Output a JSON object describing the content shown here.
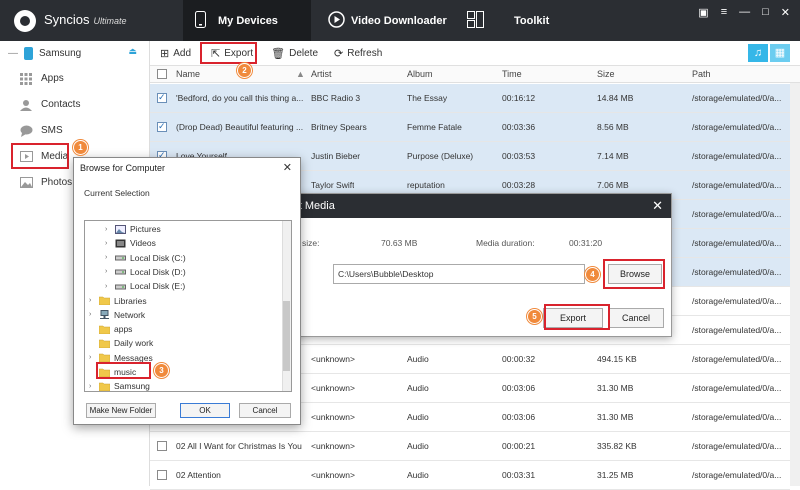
{
  "app": {
    "name": "Syncios",
    "edition": "Ultimate"
  },
  "nav": [
    {
      "label": "My Devices",
      "icon": "phone-icon"
    },
    {
      "label": "Video Downloader",
      "icon": "play-icon"
    },
    {
      "label": "Toolkit",
      "icon": "grid-icon"
    }
  ],
  "sidebar": {
    "device": "Samsung",
    "items": [
      {
        "label": "Apps"
      },
      {
        "label": "Contacts"
      },
      {
        "label": "SMS"
      },
      {
        "label": "Media"
      },
      {
        "label": "Photos"
      }
    ]
  },
  "toolbar": {
    "add": "Add",
    "export": "Export",
    "delete": "Delete",
    "refresh": "Refresh"
  },
  "columns": [
    "Name",
    "Artist",
    "Album",
    "Time",
    "Size",
    "Path"
  ],
  "rows": [
    {
      "checked": true,
      "name": "'Bedford, do you call this thing a...",
      "artist": "BBC Radio 3",
      "album": "The Essay",
      "time": "00:16:12",
      "size": "14.84 MB",
      "path": "/storage/emulated/0/a..."
    },
    {
      "checked": true,
      "name": "(Drop Dead) Beautiful featuring ...",
      "artist": "Britney Spears",
      "album": "Femme Fatale",
      "time": "00:03:36",
      "size": "8.56 MB",
      "path": "/storage/emulated/0/a..."
    },
    {
      "checked": true,
      "name": "Love Yourself",
      "artist": "Justin Bieber",
      "album": "Purpose (Deluxe)",
      "time": "00:03:53",
      "size": "7.14 MB",
      "path": "/storage/emulated/0/a..."
    },
    {
      "checked": true,
      "name": "",
      "artist": "Taylor Swift",
      "album": "reputation",
      "time": "00:03:28",
      "size": "7.06 MB",
      "path": "/storage/emulated/0/a..."
    },
    {
      "checked": true,
      "name": "",
      "artist": "",
      "album": "",
      "time": "",
      "size": "",
      "path": "/storage/emulated/0/a..."
    },
    {
      "checked": true,
      "name": "",
      "artist": "",
      "album": "",
      "time": "",
      "size": "",
      "path": "/storage/emulated/0/a..."
    },
    {
      "checked": true,
      "name": "",
      "artist": "",
      "album": "",
      "time": "",
      "size": "",
      "path": "/storage/emulated/0/a..."
    },
    {
      "checked": false,
      "name": "",
      "artist": "",
      "album": "",
      "time": "",
      "size": "",
      "path": "/storage/emulated/0/a..."
    },
    {
      "checked": false,
      "name": "",
      "artist": "",
      "album": "",
      "time": "",
      "size": "",
      "path": "/storage/emulated/0/a..."
    },
    {
      "checked": false,
      "name": "",
      "artist": "<unknown>",
      "album": "Audio",
      "time": "00:00:32",
      "size": "494.15 KB",
      "path": "/storage/emulated/0/a..."
    },
    {
      "checked": false,
      "name": "",
      "artist": "<unknown>",
      "album": "Audio",
      "time": "00:03:06",
      "size": "31.30 MB",
      "path": "/storage/emulated/0/a..."
    },
    {
      "checked": false,
      "name": "",
      "artist": "<unknown>",
      "album": "Audio",
      "time": "00:03:06",
      "size": "31.30 MB",
      "path": "/storage/emulated/0/a..."
    },
    {
      "checked": false,
      "name": "02 All I Want for Christmas Is You",
      "artist": "<unknown>",
      "album": "Audio",
      "time": "00:00:21",
      "size": "335.82 KB",
      "path": "/storage/emulated/0/a..."
    },
    {
      "checked": false,
      "name": "02 Attention",
      "artist": "<unknown>",
      "album": "Audio",
      "time": "00:03:31",
      "size": "31.25 MB",
      "path": "/storage/emulated/0/a..."
    }
  ],
  "export_dialog": {
    "title": "ort Media",
    "size_label": "ia size:",
    "size_value": "70.63 MB",
    "duration_label": "Media duration:",
    "duration_value": "00:31:20",
    "path": "C:\\Users\\Bubble\\Desktop",
    "browse": "Browse",
    "export": "Export",
    "cancel": "Cancel"
  },
  "browse_dialog": {
    "title": "Browse for Computer",
    "subtitle": "Current Selection",
    "tree": [
      {
        "label": "Pictures",
        "arrow": "›",
        "indent": 2,
        "icon": "pictures"
      },
      {
        "label": "Videos",
        "arrow": "›",
        "indent": 2,
        "icon": "videos"
      },
      {
        "label": "Local Disk (C:)",
        "arrow": "›",
        "indent": 2,
        "icon": "disk"
      },
      {
        "label": "Local Disk (D:)",
        "arrow": "›",
        "indent": 2,
        "icon": "disk"
      },
      {
        "label": "Local Disk (E:)",
        "arrow": "›",
        "indent": 2,
        "icon": "disk"
      },
      {
        "label": "Libraries",
        "arrow": "›",
        "indent": 0,
        "icon": "folder"
      },
      {
        "label": "Network",
        "arrow": "›",
        "indent": 0,
        "icon": "network"
      },
      {
        "label": "apps",
        "arrow": "",
        "indent": 0,
        "icon": "folder"
      },
      {
        "label": "Daily work",
        "arrow": "",
        "indent": 0,
        "icon": "folder"
      },
      {
        "label": "Messages",
        "arrow": "›",
        "indent": 0,
        "icon": "folder"
      },
      {
        "label": "music",
        "arrow": "",
        "indent": 0,
        "icon": "folder"
      },
      {
        "label": "Samsung",
        "arrow": "›",
        "indent": 0,
        "icon": "folder"
      }
    ],
    "new_folder": "Make New Folder",
    "ok": "OK",
    "cancel": "Cancel"
  },
  "steps": [
    "1",
    "2",
    "3",
    "4",
    "5"
  ],
  "colors": {
    "accent": "#35b7e8",
    "highlight": "#d9232d",
    "badge": "#f08a3c",
    "selected_row": "#dbe8f5",
    "titlebar": "#2b2e33"
  }
}
